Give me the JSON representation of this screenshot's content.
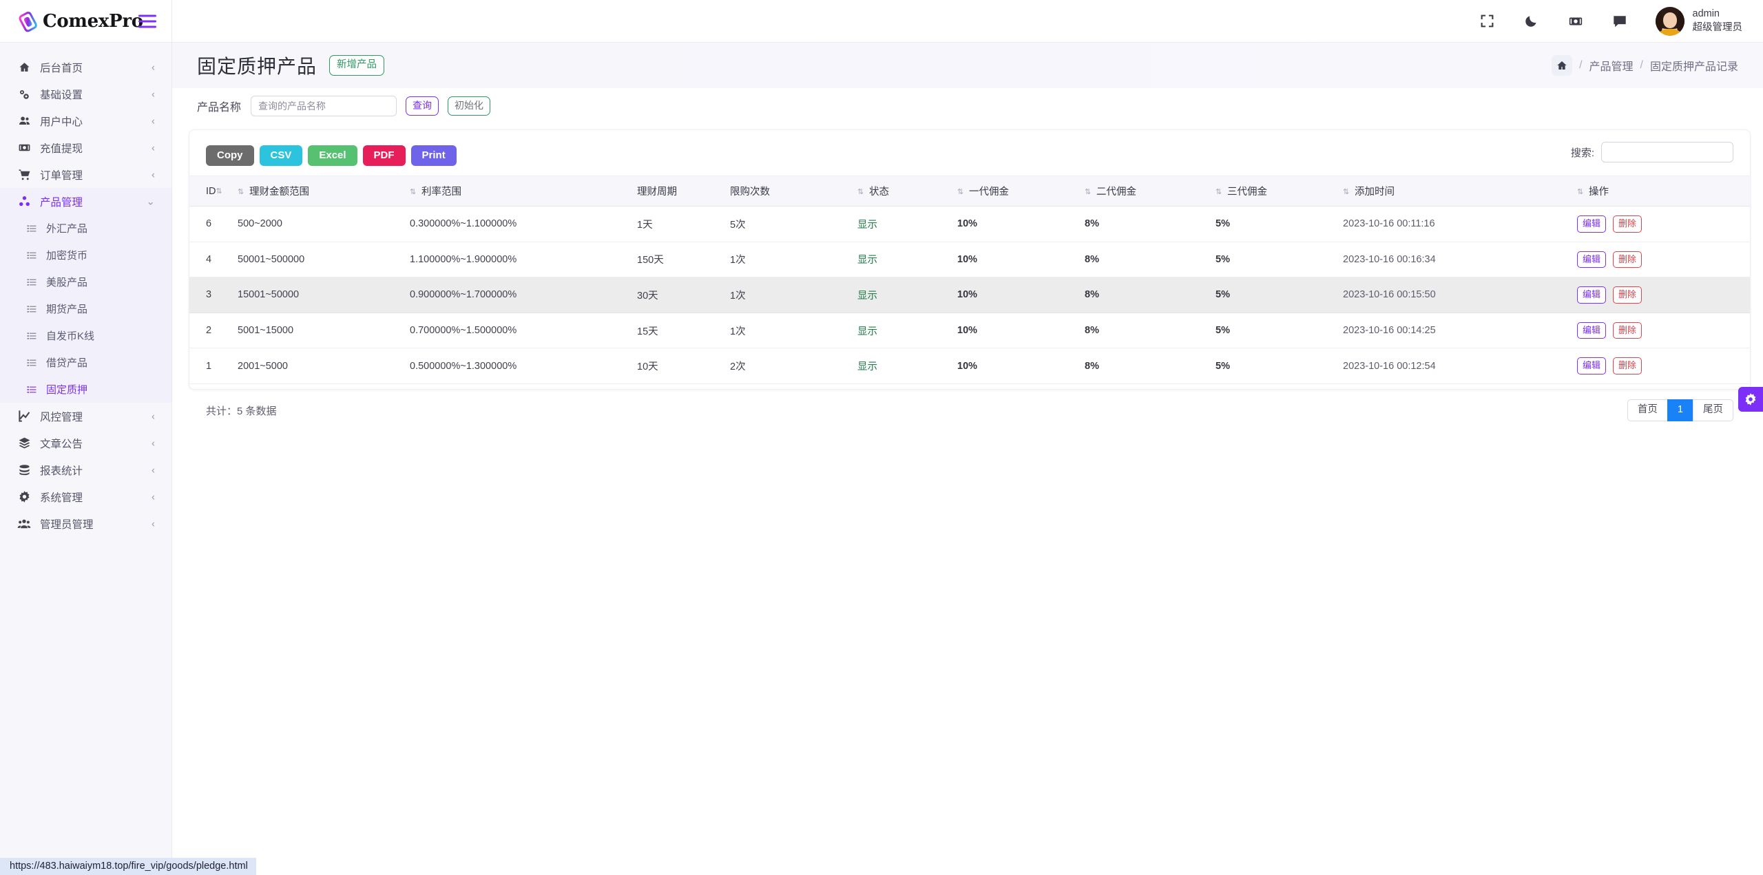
{
  "brand": {
    "name": "ComexPro",
    "menu_icon": "hamburger-icon"
  },
  "sidebar": {
    "items": [
      {
        "label": "后台首页",
        "icon": "home-icon",
        "chevron": "‹",
        "type": "group"
      },
      {
        "label": "基础设置",
        "icon": "settings-gears-icon",
        "chevron": "‹",
        "type": "group"
      },
      {
        "label": "用户中心",
        "icon": "users-icon",
        "chevron": "‹",
        "type": "group"
      },
      {
        "label": "充值提现",
        "icon": "money-icon",
        "chevron": "‹",
        "type": "group"
      },
      {
        "label": "订单管理",
        "icon": "cart-icon",
        "chevron": "‹",
        "type": "group"
      },
      {
        "label": "产品管理",
        "icon": "product-nodes-icon",
        "chevron": "⌄",
        "type": "group-open"
      },
      {
        "label": "外汇产品",
        "icon": "list-icon",
        "type": "sub"
      },
      {
        "label": "加密货币",
        "icon": "list-icon",
        "type": "sub"
      },
      {
        "label": "美股产品",
        "icon": "list-icon",
        "type": "sub"
      },
      {
        "label": "期货产品",
        "icon": "list-icon",
        "type": "sub"
      },
      {
        "label": "自发币K线",
        "icon": "list-icon",
        "type": "sub"
      },
      {
        "label": "借贷产品",
        "icon": "list-icon",
        "type": "sub"
      },
      {
        "label": "固定质押",
        "icon": "list-icon",
        "type": "sub-current"
      },
      {
        "label": "风控管理",
        "icon": "chart-line-icon",
        "chevron": "‹",
        "type": "group"
      },
      {
        "label": "文章公告",
        "icon": "layers-icon",
        "chevron": "‹",
        "type": "group"
      },
      {
        "label": "报表统计",
        "icon": "coins-icon",
        "chevron": "‹",
        "type": "group"
      },
      {
        "label": "系统管理",
        "icon": "gear-icon",
        "chevron": "‹",
        "type": "group"
      },
      {
        "label": "管理员管理",
        "icon": "admin-users-icon",
        "chevron": "‹",
        "type": "group"
      }
    ]
  },
  "topbar": {
    "icons": [
      "fullscreen-icon",
      "moon-icon",
      "cash-icon",
      "chat-icon"
    ],
    "user_name": "admin",
    "user_role": "超级管理员"
  },
  "page": {
    "title": "固定质押产品",
    "add_button": "新增产品",
    "breadcrumb": {
      "home_icon": "home-icon",
      "sep": "/",
      "items": [
        "产品管理",
        "固定质押产品记录"
      ]
    }
  },
  "filter": {
    "label": "产品名称",
    "placeholder": "查询的产品名称",
    "value": "",
    "query_button": "查询",
    "reset_button": "初始化"
  },
  "export_buttons": [
    {
      "label": "Copy",
      "color": "#6c6c6c"
    },
    {
      "label": "CSV",
      "color": "#2cc3de"
    },
    {
      "label": "Excel",
      "color": "#56c271"
    },
    {
      "label": "PDF",
      "color": "#e61e5a"
    },
    {
      "label": "Print",
      "color": "#6f63ea"
    }
  ],
  "search": {
    "label": "搜索:",
    "value": "",
    "placeholder": ""
  },
  "table": {
    "columns": [
      {
        "label": "ID",
        "sortable": true
      },
      {
        "label": "理财金额范围",
        "sortable": true
      },
      {
        "label": "利率范围",
        "sortable": true
      },
      {
        "label": "理财周期",
        "sortable": false
      },
      {
        "label": "限购次数",
        "sortable": false
      },
      {
        "label": "状态",
        "sortable": true
      },
      {
        "label": "一代佣金",
        "sortable": true
      },
      {
        "label": "二代佣金",
        "sortable": true
      },
      {
        "label": "三代佣金",
        "sortable": true
      },
      {
        "label": "添加时间",
        "sortable": true
      },
      {
        "label": "操作",
        "sortable": true
      }
    ],
    "rows": [
      {
        "id": "6",
        "amount": "500~2000",
        "rate": "0.300000%~1.100000%",
        "period": "1天",
        "limit": "5次",
        "status": "显示",
        "c1": "10%",
        "c2": "8%",
        "c3": "5%",
        "time": "2023-10-16 00:11:16",
        "edit": "编辑",
        "del": "删除"
      },
      {
        "id": "4",
        "amount": "50001~500000",
        "rate": "1.100000%~1.900000%",
        "period": "150天",
        "limit": "1次",
        "status": "显示",
        "c1": "10%",
        "c2": "8%",
        "c3": "5%",
        "time": "2023-10-16 00:16:34",
        "edit": "编辑",
        "del": "删除"
      },
      {
        "id": "3",
        "amount": "15001~50000",
        "rate": "0.900000%~1.700000%",
        "period": "30天",
        "limit": "1次",
        "status": "显示",
        "c1": "10%",
        "c2": "8%",
        "c3": "5%",
        "time": "2023-10-16 00:15:50",
        "edit": "编辑",
        "del": "删除"
      },
      {
        "id": "2",
        "amount": "5001~15000",
        "rate": "0.700000%~1.500000%",
        "period": "15天",
        "limit": "1次",
        "status": "显示",
        "c1": "10%",
        "c2": "8%",
        "c3": "5%",
        "time": "2023-10-16 00:14:25",
        "edit": "编辑",
        "del": "删除"
      },
      {
        "id": "1",
        "amount": "2001~5000",
        "rate": "0.500000%~1.300000%",
        "period": "10天",
        "limit": "2次",
        "status": "显示",
        "c1": "10%",
        "c2": "8%",
        "c3": "5%",
        "time": "2023-10-16 00:12:54",
        "edit": "编辑",
        "del": "删除"
      }
    ]
  },
  "footer": {
    "total_text": "共计：5 条数据",
    "pager": {
      "first": "首页",
      "current": "1",
      "last": "尾页"
    }
  },
  "fab": {
    "icon": "gear-icon"
  },
  "status_bar": {
    "url": "https://483.haiwaiym18.top/fire_vip/goods/pledge.html"
  },
  "colors": {
    "accent": "#7b2ff7",
    "green": "#2e9960",
    "danger": "#e0434a",
    "page_active": "#1a82f7"
  }
}
